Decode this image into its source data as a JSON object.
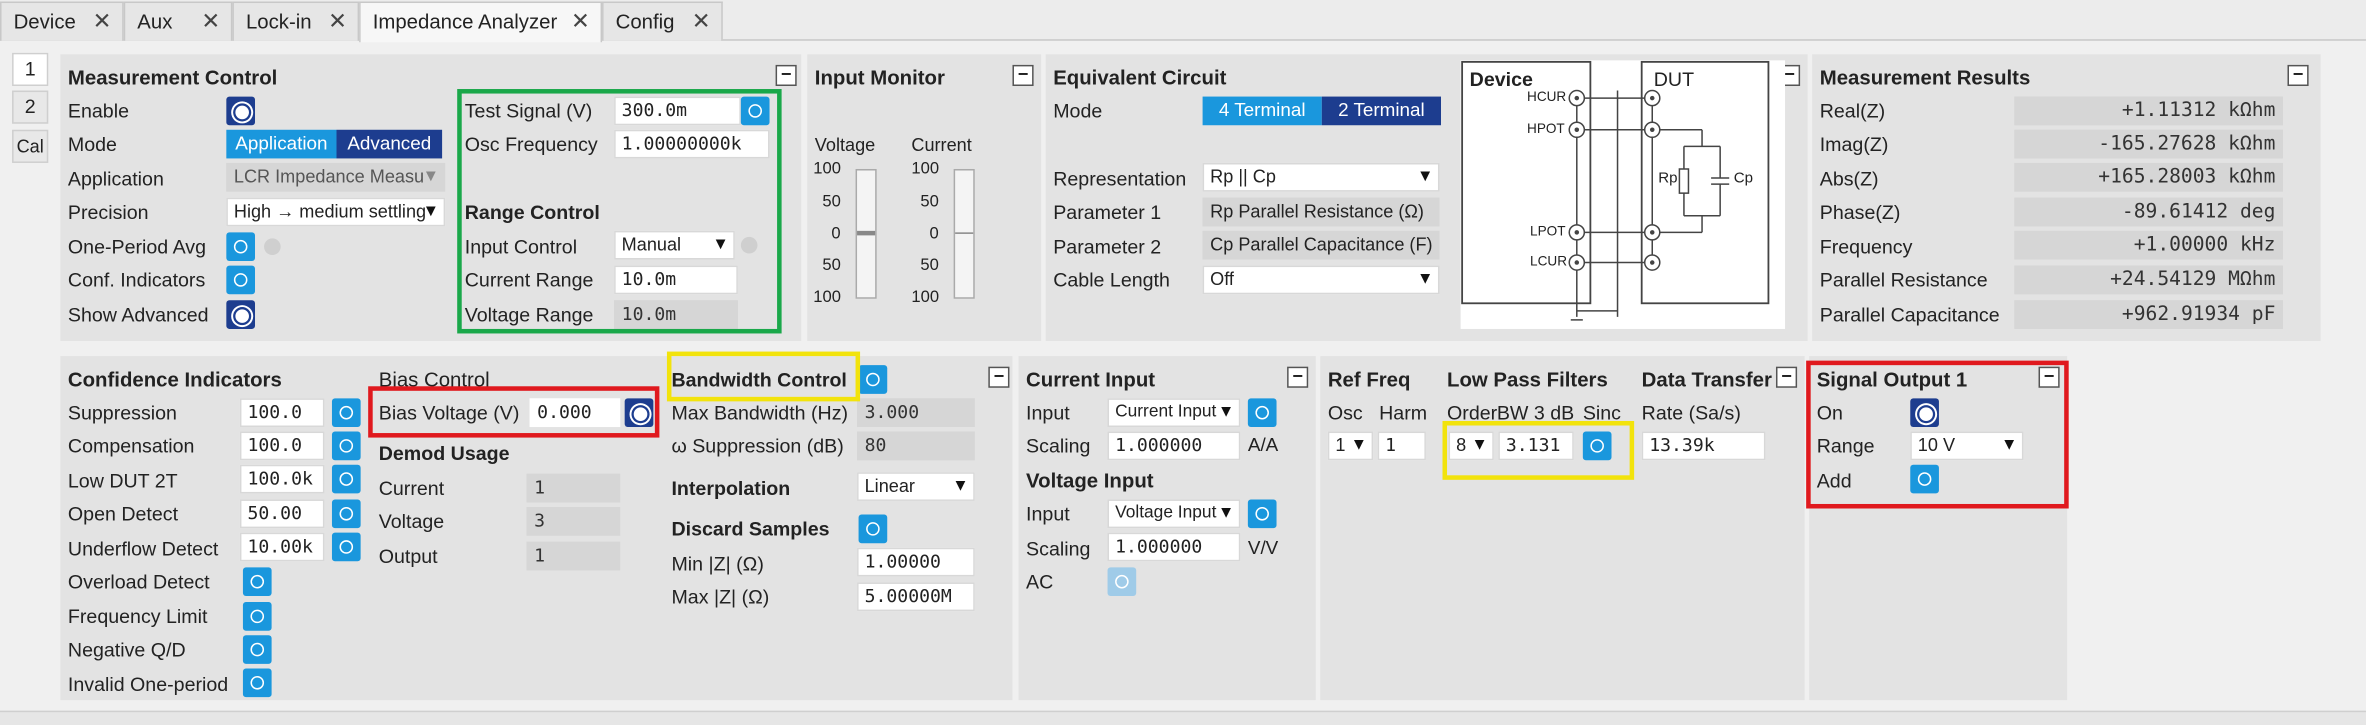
{
  "tabs": [
    {
      "label": "Device"
    },
    {
      "label": "Aux"
    },
    {
      "label": "Lock-in"
    },
    {
      "label": "Impedance Analyzer"
    },
    {
      "label": "Config"
    }
  ],
  "side_tabs": [
    "1",
    "2",
    "Cal"
  ],
  "measurement_control": {
    "title": "Measurement Control",
    "enable": "Enable",
    "mode": "Mode",
    "mode_app": "Application",
    "mode_adv": "Advanced",
    "application": "Application",
    "application_value": "LCR Impedance Measu",
    "precision": "Precision",
    "precision_value": "High → medium settling",
    "one_period": "One-Period Avg",
    "conf_ind": "Conf. Indicators",
    "show_adv": "Show Advanced"
  },
  "test_signal": {
    "label": "Test Signal (V)",
    "value": "300.0m",
    "osc_label": "Osc Frequency",
    "osc_value": "1.00000000k",
    "range_title": "Range Control",
    "input_control": "Input Control",
    "input_control_value": "Manual",
    "current_range": "Current Range",
    "current_range_value": "10.0m",
    "voltage_range": "Voltage Range",
    "voltage_range_value": "10.0m"
  },
  "input_monitor": {
    "title": "Input Monitor",
    "voltage": "Voltage",
    "current": "Current",
    "ticks": [
      "100",
      "50",
      "0",
      "50",
      "100"
    ]
  },
  "equivalent_circuit": {
    "title": "Equivalent Circuit",
    "mode": "Mode",
    "four": "4 Terminal",
    "two": "2 Terminal",
    "representation": "Representation",
    "representation_value": "Rp || Cp",
    "param1": "Parameter 1",
    "param1_value": "Rp Parallel Resistance (Ω)",
    "param2": "Parameter 2",
    "param2_value": "Cp Parallel Capacitance (F)",
    "cable": "Cable Length",
    "cable_value": "Off",
    "device": "Device",
    "dut": "DUT",
    "hcur": "HCUR",
    "hpot": "HPOT",
    "lpot": "LPOT",
    "lcur": "LCUR",
    "rp": "Rp",
    "cp": "Cp"
  },
  "results": {
    "title": "Measurement Results",
    "rows": [
      {
        "label": "Real(Z)",
        "value": "+1.11312 kΩhm"
      },
      {
        "label": "Imag(Z)",
        "value": "-165.27628 kΩhm"
      },
      {
        "label": "Abs(Z)",
        "value": "+165.28003 kΩhm"
      },
      {
        "label": "Phase(Z)",
        "value": "-89.61412 deg"
      },
      {
        "label": "Frequency",
        "value": "+1.00000 kHz"
      },
      {
        "label": "Parallel Resistance",
        "value": "+24.54129 MΩhm"
      },
      {
        "label": "Parallel Capacitance",
        "value": "+962.91934 pF"
      }
    ]
  },
  "confidence": {
    "title": "Confidence Indicators",
    "rows": [
      {
        "label": "Suppression",
        "value": "100.0"
      },
      {
        "label": "Compensation",
        "value": "100.0"
      },
      {
        "label": "Low DUT 2T",
        "value": "100.0k"
      },
      {
        "label": "Open Detect",
        "value": "50.00"
      },
      {
        "label": "Underflow Detect",
        "value": "10.00k"
      },
      {
        "label": "Overload Detect",
        "value": ""
      },
      {
        "label": "Frequency Limit",
        "value": ""
      },
      {
        "label": "Negative Q/D",
        "value": ""
      },
      {
        "label": "Invalid One-period",
        "value": ""
      }
    ]
  },
  "bias": {
    "title": "Bias Control",
    "label": "Bias Voltage (V)",
    "value": "0.000"
  },
  "demod": {
    "title": "Demod Usage",
    "current": "Current",
    "current_value": "1",
    "voltage": "Voltage",
    "voltage_value": "3",
    "output": "Output",
    "output_value": "1"
  },
  "bandwidth": {
    "title": "Bandwidth Control",
    "max_bw": "Max Bandwidth (Hz)",
    "max_bw_value": "3.000",
    "omega": "ω Suppression (dB)",
    "omega_value": "80",
    "interp": "Interpolation",
    "interp_value": "Linear",
    "discard": "Discard Samples",
    "minz": "Min |Z| (Ω)",
    "minz_value": "1.00000",
    "maxz": "Max |Z| (Ω)",
    "maxz_value": "5.00000M"
  },
  "current_input": {
    "title": "Current Input",
    "input": "Input",
    "input_value": "Current Input",
    "scaling": "Scaling",
    "scaling_value": "1.000000",
    "unit": "A/A",
    "v_title": "Voltage Input",
    "v_input_value": "Voltage Input",
    "v_scaling_value": "1.000000",
    "v_unit": "V/V",
    "ac": "AC"
  },
  "ref_freq": {
    "title": "Ref Freq",
    "osc": "Osc",
    "harm": "Harm",
    "osc_value": "1",
    "harm_value": "1"
  },
  "lpf": {
    "title": "Low Pass Filters",
    "order": "Order",
    "bw": "BW 3 dB",
    "sinc": "Sinc",
    "order_value": "8",
    "bw_value": "3.131"
  },
  "data_transfer": {
    "title": "Data Transfer",
    "rate": "Rate (Sa/s)",
    "rate_value": "13.39k"
  },
  "signal_output": {
    "title": "Signal Output 1",
    "on": "On",
    "range": "Range",
    "range_value": "10 V",
    "add": "Add"
  },
  "colors": {
    "accent": "#1a97dd",
    "toggle_on": "#1d3d8f",
    "highlight_green": "#1aa84a",
    "highlight_red": "#e0191e",
    "highlight_yellow": "#f2e30c"
  }
}
